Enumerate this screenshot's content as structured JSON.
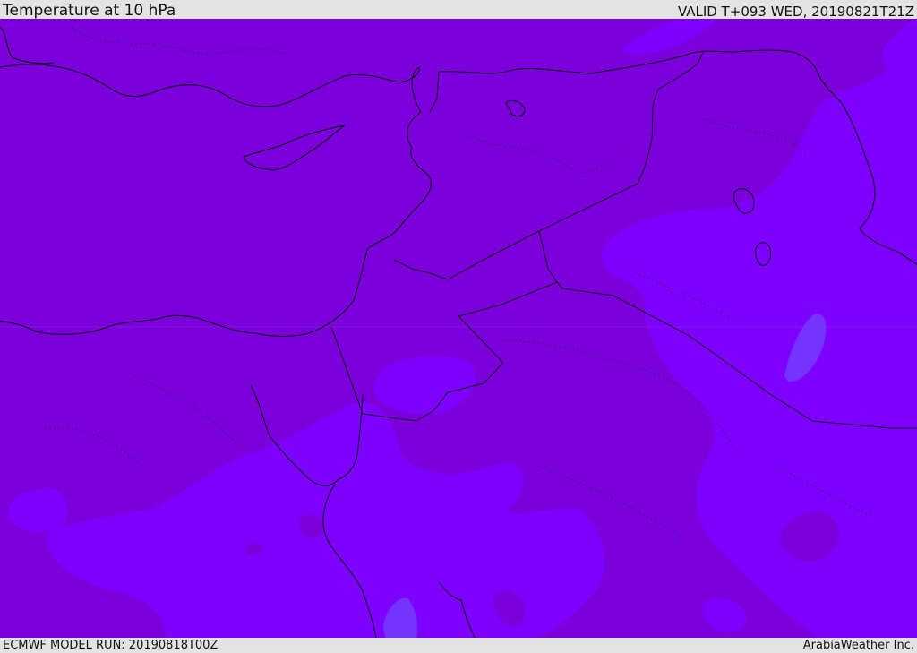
{
  "header": {
    "title": "Temperature at 10 hPa",
    "valid_time": "VALID T+093 WED, 20190821T21Z"
  },
  "footer": {
    "model_run": "ECMWF MODEL RUN: 20190818T00Z",
    "credit": "ArabiaWeather Inc."
  },
  "map": {
    "region": "Eastern Mediterranean and Middle East",
    "colors": {
      "warm_shade": "#7b00db",
      "cool_shade": "#7e00ff",
      "coolest_shade": "#7533ff",
      "coastline": "#000000",
      "border": "#111111"
    }
  }
}
